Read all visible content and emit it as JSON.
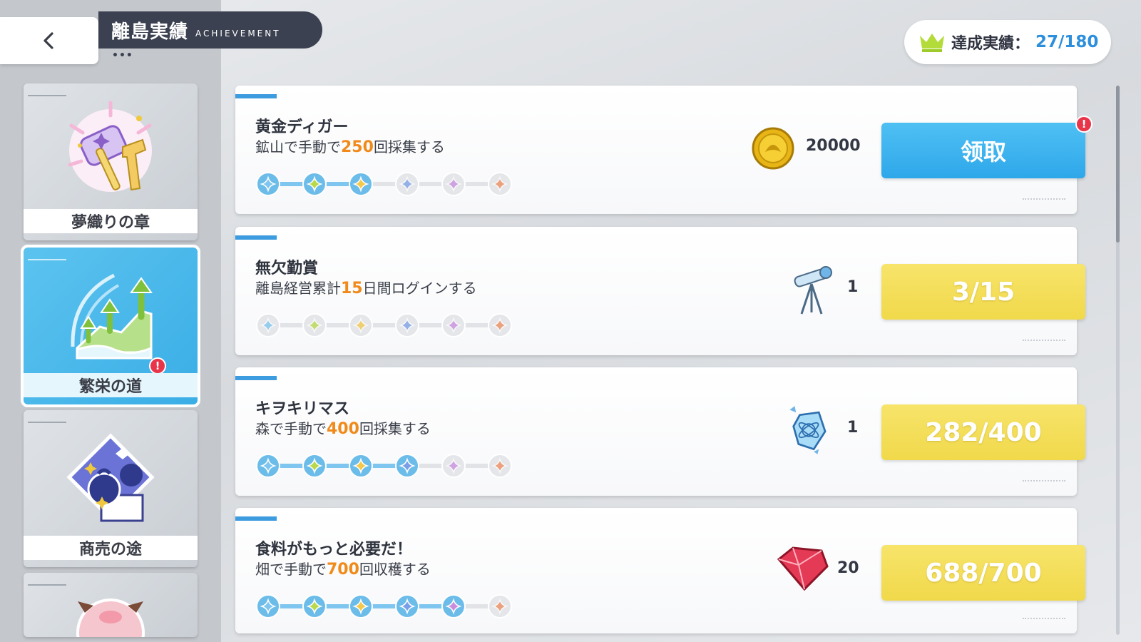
{
  "header": {
    "title": "離島実績",
    "subtitle": "ACHIEVEMENT",
    "dots": "•••"
  },
  "counter": {
    "label": "達成実績：",
    "value": "27/180"
  },
  "sidebar": {
    "categories": [
      {
        "label": "夢織りの章",
        "icon": "hammer-icon"
      },
      {
        "label": "繁栄の道",
        "icon": "growth-arrows-icon",
        "active": true,
        "alert": "!"
      },
      {
        "label": "商売の途",
        "icon": "bag-icon"
      },
      {
        "label": "",
        "icon": "pig-icon"
      }
    ]
  },
  "achievements": [
    {
      "name": "黄金ディガー",
      "desc_pre": "鉱山で手動で",
      "desc_num": "250",
      "desc_post": "回採集する",
      "stars_filled": 3,
      "reward_icon": "gold-coin-icon",
      "reward_qty": "20000",
      "button": "领取",
      "button_state": "claim",
      "alert": "!"
    },
    {
      "name": "無欠勤賞",
      "desc_pre": "離島経営累計",
      "desc_num": "15",
      "desc_post": "日間ログインする",
      "stars_filled": 0,
      "reward_icon": "telescope-icon",
      "reward_qty": "1",
      "button": "3/15",
      "button_state": "progress"
    },
    {
      "name": "キヲキリマス",
      "desc_pre": "森で手動で",
      "desc_num": "400",
      "desc_post": "回採集する",
      "stars_filled": 4,
      "reward_icon": "crystal-icon",
      "reward_qty": "1",
      "button": "282/400",
      "button_state": "progress"
    },
    {
      "name": "食料がもっと必要だ！",
      "desc_pre": "畑で手動で",
      "desc_num": "700",
      "desc_post": "回収穫する",
      "stars_filled": 5,
      "reward_icon": "ruby-gem-icon",
      "reward_qty": "20",
      "button": "688/700",
      "button_state": "progress"
    }
  ],
  "colors": {
    "accent_blue": "#2ea7ea",
    "progress_yellow": "#f1d94b",
    "highlight_number": "#f08a1a",
    "alert_red": "#e8354a",
    "star_colors": [
      "#7ec6ef",
      "#b8d94a",
      "#f2c94c",
      "#7a9fe8",
      "#c98de0",
      "#ee8a5a"
    ]
  }
}
